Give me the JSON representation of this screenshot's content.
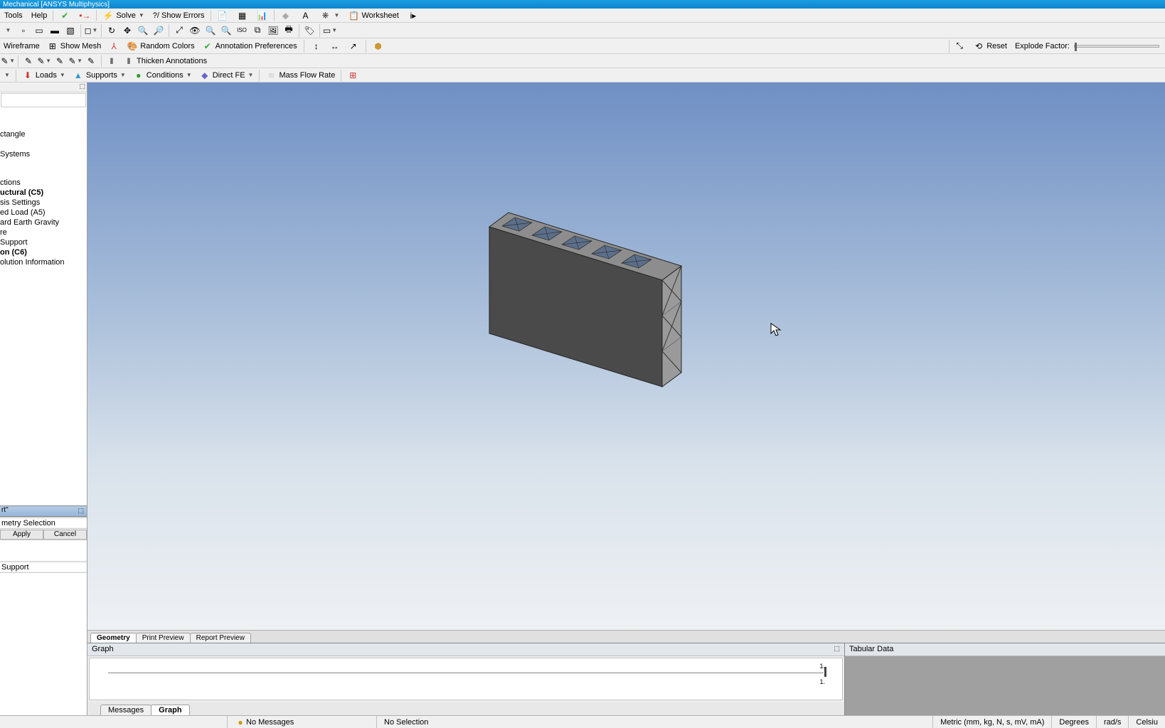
{
  "title": "Mechanical [ANSYS Multiphysics]",
  "menu": {
    "tools": "Tools",
    "help": "Help"
  },
  "menubar_buttons": {
    "solve": "Solve",
    "show_errors": "?/ Show Errors",
    "worksheet": "Worksheet"
  },
  "toolbar3": {
    "wireframe": "Wireframe",
    "show_mesh": "Show Mesh",
    "random_colors": "Random Colors",
    "annotation_prefs": "Annotation Preferences",
    "reset": "Reset",
    "explode_factor": "Explode Factor:"
  },
  "toolbar4": {
    "thicken": "Thicken Annotations"
  },
  "toolbar5": {
    "loads": "Loads",
    "supports": "Supports",
    "conditions": "Conditions",
    "direct_fe": "Direct FE",
    "mass_flow": "Mass Flow Rate"
  },
  "tree": {
    "items": [
      {
        "label": "ctangle",
        "bold": false
      },
      {
        "label": "Systems",
        "bold": false
      },
      {
        "label": "ctions",
        "bold": false
      },
      {
        "label": "uctural (C5)",
        "bold": true
      },
      {
        "label": "sis Settings",
        "bold": false
      },
      {
        "label": "ed Load (A5)",
        "bold": false
      },
      {
        "label": "ard Earth Gravity",
        "bold": false
      },
      {
        "label": "re",
        "bold": false
      },
      {
        "label": "Support",
        "bold": false
      },
      {
        "label": "on (C6)",
        "bold": true
      },
      {
        "label": "olution Information",
        "bold": false
      }
    ]
  },
  "details_header": "rt\"",
  "details": {
    "scoping_value": "metry Selection",
    "apply": "Apply",
    "cancel": "Cancel",
    "type_value": "Support"
  },
  "view_tabs": {
    "geometry": "Geometry",
    "print_preview": "Print Preview",
    "report_preview": "Report Preview"
  },
  "graph": {
    "title": "Graph",
    "tick1": "1.",
    "tick2": "1."
  },
  "graph_tabs": {
    "messages": "Messages",
    "graph": "Graph"
  },
  "tabular": {
    "title": "Tabular Data"
  },
  "status": {
    "no_messages": "No Messages",
    "no_selection": "No Selection",
    "units": "Metric (mm, kg, N, s, mV, mA)",
    "degrees": "Degrees",
    "rads": "rad/s",
    "celsius": "Celsiu"
  }
}
